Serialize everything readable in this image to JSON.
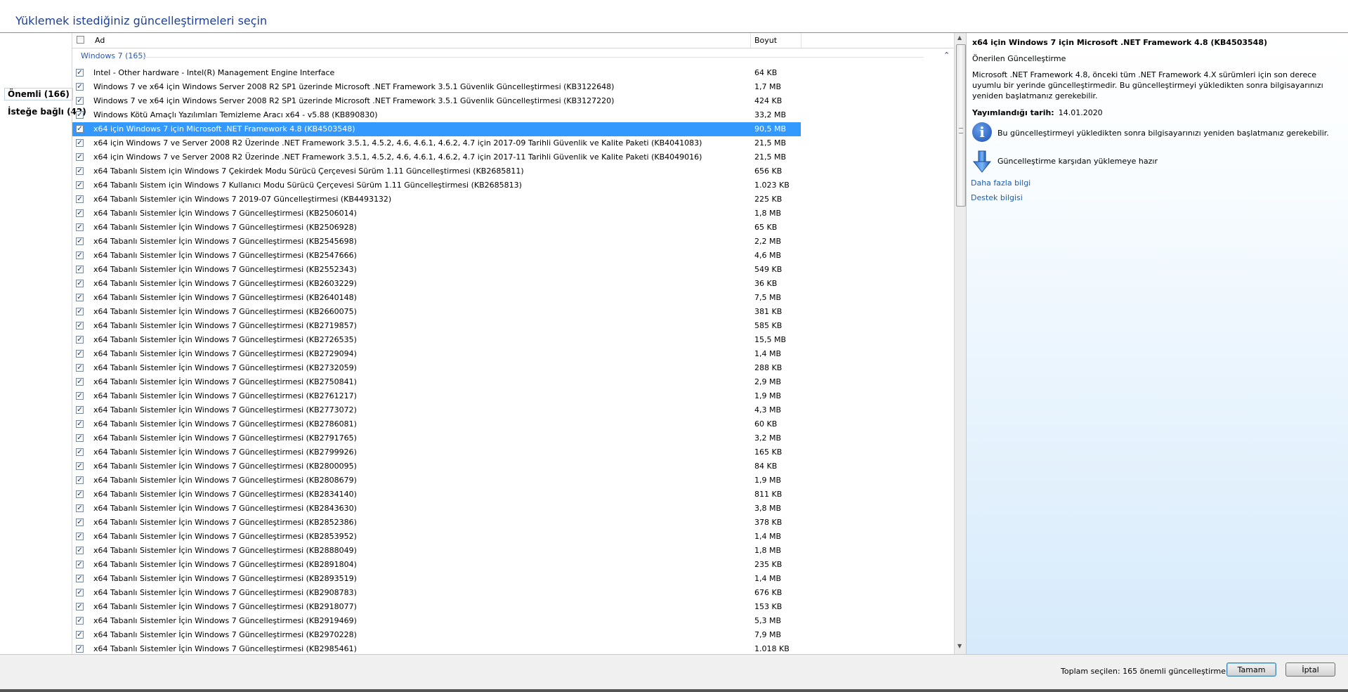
{
  "window_title": "Yüklemek istediğiniz güncelleştirmeleri seçin",
  "categories": [
    {
      "label": "Önemli (166)"
    },
    {
      "label": "İsteğe bağlı (42)"
    }
  ],
  "list": {
    "header": {
      "name": "Ad",
      "size": "Boyut"
    },
    "group": "Windows 7 (165)",
    "rows": [
      {
        "name": "Intel - Other hardware - Intel(R) Management Engine Interface",
        "size": "64 KB",
        "checked": true
      },
      {
        "name": "Windows 7 ve x64 için Windows Server 2008 R2 SP1 üzerinde Microsoft .NET Framework 3.5.1 Güvenlik Güncelleştirmesi (KB3122648)",
        "size": "1,7 MB",
        "checked": true
      },
      {
        "name": "Windows 7 ve x64 için Windows Server 2008 R2 SP1 üzerinde Microsoft .NET Framework 3.5.1 Güvenlik Güncelleştirmesi (KB3127220)",
        "size": "424 KB",
        "checked": true
      },
      {
        "name": "Windows Kötü Amaçlı Yazılımları Temizleme Aracı x64 - v5.88 (KB890830)",
        "size": "33,2 MB",
        "checked": true
      },
      {
        "name": "x64 için Windows 7 için Microsoft .NET Framework 4.8 (KB4503548)",
        "size": "90,5 MB",
        "checked": true,
        "selected": true
      },
      {
        "name": "x64 için Windows 7 ve Server 2008 R2 Üzerinde .NET Framework 3.5.1, 4.5.2, 4.6, 4.6.1, 4.6.2, 4.7 için 2017-09 Tarihli Güvenlik ve Kalite Paketi (KB4041083)",
        "size": "21,5 MB",
        "checked": true
      },
      {
        "name": "x64 için Windows 7 ve Server 2008 R2 Üzerinde .NET Framework 3.5.1, 4.5.2, 4.6, 4.6.1, 4.6.2, 4.7 için 2017-11 Tarihli Güvenlik ve Kalite Paketi (KB4049016)",
        "size": "21,5 MB",
        "checked": true
      },
      {
        "name": "x64 Tabanlı Sistem için Windows 7 Çekirdek Modu Sürücü Çerçevesi Sürüm 1.11 Güncelleştirmesi (KB2685811)",
        "size": "656 KB",
        "checked": true
      },
      {
        "name": "x64 Tabanlı Sistem için Windows 7 Kullanıcı Modu Sürücü Çerçevesi Sürüm 1.11 Güncelleştirmesi (KB2685813)",
        "size": "1.023 KB",
        "checked": true
      },
      {
        "name": "x64 Tabanlı Sistemler için Windows 7 2019-07 Güncelleştirmesi (KB4493132)",
        "size": "225 KB",
        "checked": true
      },
      {
        "name": "x64 Tabanlı Sistemler İçin Windows 7 Güncelleştirmesi (KB2506014)",
        "size": "1,8 MB",
        "checked": true
      },
      {
        "name": "x64 Tabanlı Sistemler İçin Windows 7 Güncelleştirmesi (KB2506928)",
        "size": "65 KB",
        "checked": true
      },
      {
        "name": "x64 Tabanlı Sistemler İçin Windows 7 Güncelleştirmesi (KB2545698)",
        "size": "2,2 MB",
        "checked": true
      },
      {
        "name": "x64 Tabanlı Sistemler İçin Windows 7 Güncelleştirmesi (KB2547666)",
        "size": "4,6 MB",
        "checked": true
      },
      {
        "name": "x64 Tabanlı Sistemler İçin Windows 7 Güncelleştirmesi (KB2552343)",
        "size": "549 KB",
        "checked": true
      },
      {
        "name": "x64 Tabanlı Sistemler İçin Windows 7 Güncelleştirmesi (KB2603229)",
        "size": "36 KB",
        "checked": true
      },
      {
        "name": "x64 Tabanlı Sistemler İçin Windows 7 Güncelleştirmesi (KB2640148)",
        "size": "7,5 MB",
        "checked": true
      },
      {
        "name": "x64 Tabanlı Sistemler İçin Windows 7 Güncelleştirmesi (KB2660075)",
        "size": "381 KB",
        "checked": true
      },
      {
        "name": "x64 Tabanlı Sistemler İçin Windows 7 Güncelleştirmesi (KB2719857)",
        "size": "585 KB",
        "checked": true
      },
      {
        "name": "x64 Tabanlı Sistemler İçin Windows 7 Güncelleştirmesi (KB2726535)",
        "size": "15,5 MB",
        "checked": true
      },
      {
        "name": "x64 Tabanlı Sistemler İçin Windows 7 Güncelleştirmesi (KB2729094)",
        "size": "1,4 MB",
        "checked": true
      },
      {
        "name": "x64 Tabanlı Sistemler İçin Windows 7 Güncelleştirmesi (KB2732059)",
        "size": "288 KB",
        "checked": true
      },
      {
        "name": "x64 Tabanlı Sistemler İçin Windows 7 Güncelleştirmesi (KB2750841)",
        "size": "2,9 MB",
        "checked": true
      },
      {
        "name": "x64 Tabanlı Sistemler İçin Windows 7 Güncelleştirmesi (KB2761217)",
        "size": "1,9 MB",
        "checked": true
      },
      {
        "name": "x64 Tabanlı Sistemler İçin Windows 7 Güncelleştirmesi (KB2773072)",
        "size": "4,3 MB",
        "checked": true
      },
      {
        "name": "x64 Tabanlı Sistemler İçin Windows 7 Güncelleştirmesi (KB2786081)",
        "size": "60 KB",
        "checked": true
      },
      {
        "name": "x64 Tabanlı Sistemler İçin Windows 7 Güncelleştirmesi (KB2791765)",
        "size": "3,2 MB",
        "checked": true
      },
      {
        "name": "x64 Tabanlı Sistemler İçin Windows 7 Güncelleştirmesi (KB2799926)",
        "size": "165 KB",
        "checked": true
      },
      {
        "name": "x64 Tabanlı Sistemler İçin Windows 7 Güncelleştirmesi (KB2800095)",
        "size": "84 KB",
        "checked": true
      },
      {
        "name": "x64 Tabanlı Sistemler İçin Windows 7 Güncelleştirmesi (KB2808679)",
        "size": "1,9 MB",
        "checked": true
      },
      {
        "name": "x64 Tabanlı Sistemler İçin Windows 7 Güncelleştirmesi (KB2834140)",
        "size": "811 KB",
        "checked": true
      },
      {
        "name": "x64 Tabanlı Sistemler İçin Windows 7 Güncelleştirmesi (KB2843630)",
        "size": "3,8 MB",
        "checked": true
      },
      {
        "name": "x64 Tabanlı Sistemler İçin Windows 7 Güncelleştirmesi (KB2852386)",
        "size": "378 KB",
        "checked": true
      },
      {
        "name": "x64 Tabanlı Sistemler İçin Windows 7 Güncelleştirmesi (KB2853952)",
        "size": "1,4 MB",
        "checked": true
      },
      {
        "name": "x64 Tabanlı Sistemler İçin Windows 7 Güncelleştirmesi (KB2888049)",
        "size": "1,8 MB",
        "checked": true
      },
      {
        "name": "x64 Tabanlı Sistemler İçin Windows 7 Güncelleştirmesi (KB2891804)",
        "size": "235 KB",
        "checked": true
      },
      {
        "name": "x64 Tabanlı Sistemler İçin Windows 7 Güncelleştirmesi (KB2893519)",
        "size": "1,4 MB",
        "checked": true
      },
      {
        "name": "x64 Tabanlı Sistemler İçin Windows 7 Güncelleştirmesi (KB2908783)",
        "size": "676 KB",
        "checked": true
      },
      {
        "name": "x64 Tabanlı Sistemler İçin Windows 7 Güncelleştirmesi (KB2918077)",
        "size": "153 KB",
        "checked": true
      },
      {
        "name": "x64 Tabanlı Sistemler İçin Windows 7 Güncelleştirmesi (KB2919469)",
        "size": "5,3 MB",
        "checked": true
      },
      {
        "name": "x64 Tabanlı Sistemler İçin Windows 7 Güncelleştirmesi (KB2970228)",
        "size": "7,9 MB",
        "checked": true
      },
      {
        "name": "x64 Tabanlı Sistemler İçin Windows 7 Güncelleştirmesi (KB2985461)",
        "size": "1.018 KB",
        "checked": true
      }
    ]
  },
  "details": {
    "title": "x64 için Windows 7 için Microsoft .NET Framework 4.8 (KB4503548)",
    "type": "Önerilen Güncelleştirme",
    "description": "Microsoft .NET Framework 4.8, önceki tüm .NET Framework 4.X sürümleri için son derece uyumlu bir yerinde güncelleştirmedir. Bu güncelleştirmeyi yükledikten sonra bilgisayarınızı yeniden başlatmanız gerekebilir.",
    "published_label": "Yayımlandığı tarih:",
    "published_value": "14.01.2020",
    "restart_icon_glyph": "i",
    "restart_note": "Bu güncelleştirmeyi yükledikten sonra bilgisayarınızı yeniden başlatmanız gerekebilir.",
    "ready_note": "Güncelleştirme karşıdan yüklemeye hazır",
    "more_info": "Daha fazla bilgi",
    "support_info": "Destek bilgisi"
  },
  "footer": {
    "total": "Toplam seçilen: 165 önemli güncelleştirme",
    "ok": "Tamam",
    "cancel": "İptal"
  },
  "colors": {
    "title": "#1e3f99",
    "selection": "#3399ff",
    "link": "#1e5bb5"
  }
}
